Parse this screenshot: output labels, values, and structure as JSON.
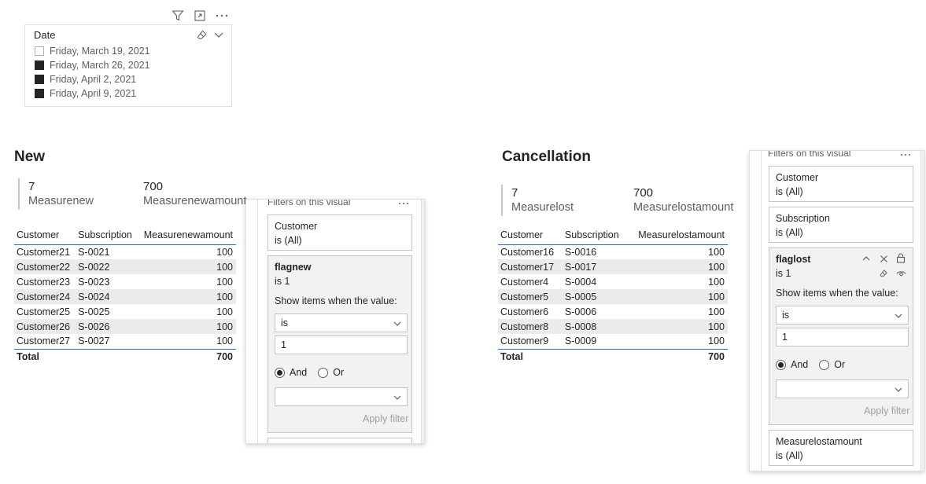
{
  "slicer": {
    "title": "Date",
    "items": [
      {
        "label": "Friday, March 19, 2021",
        "checked": false
      },
      {
        "label": "Friday, March 26, 2021",
        "checked": true
      },
      {
        "label": "Friday, April 2, 2021",
        "checked": true
      },
      {
        "label": "Friday, April 9, 2021",
        "checked": true
      }
    ]
  },
  "new": {
    "title": "New",
    "card1": {
      "value": "7",
      "label": "Measurenew"
    },
    "card2": {
      "value": "700",
      "label": "Measurenewamount"
    },
    "table": {
      "headers": [
        "Customer",
        "Subscription",
        "Measurenewamount"
      ],
      "rows": [
        [
          "Customer21",
          "S-0021",
          "100"
        ],
        [
          "Customer22",
          "S-0022",
          "100"
        ],
        [
          "Customer23",
          "S-0023",
          "100"
        ],
        [
          "Customer24",
          "S-0024",
          "100"
        ],
        [
          "Customer25",
          "S-0025",
          "100"
        ],
        [
          "Customer26",
          "S-0026",
          "100"
        ],
        [
          "Customer27",
          "S-0027",
          "100"
        ]
      ],
      "total_label": "Total",
      "total_value": "700"
    }
  },
  "cancel": {
    "title": "Cancellation",
    "card1": {
      "value": "7",
      "label": "Measurelost"
    },
    "card2": {
      "value": "700",
      "label": "Measurelostamount"
    },
    "table": {
      "headers": [
        "Customer",
        "Subscription",
        "Measurelostamount"
      ],
      "rows": [
        [
          "Customer16",
          "S-0016",
          "100"
        ],
        [
          "Customer17",
          "S-0017",
          "100"
        ],
        [
          "Customer4",
          "S-0004",
          "100"
        ],
        [
          "Customer5",
          "S-0005",
          "100"
        ],
        [
          "Customer6",
          "S-0006",
          "100"
        ],
        [
          "Customer8",
          "S-0008",
          "100"
        ],
        [
          "Customer9",
          "S-0009",
          "100"
        ]
      ],
      "total_label": "Total",
      "total_value": "700"
    }
  },
  "pane_left": {
    "header": "Filters on this visual",
    "customer": {
      "name": "Customer",
      "state": "is (All)"
    },
    "flag": {
      "name": "flagnew",
      "state": "is 1",
      "show_label": "Show items when the value:",
      "operator": "is",
      "value": "1",
      "and_label": "And",
      "or_label": "Or",
      "apply_label": "Apply filter"
    }
  },
  "pane_right": {
    "header": "Filters on this visual",
    "customer": {
      "name": "Customer",
      "state": "is (All)"
    },
    "subscription": {
      "name": "Subscription",
      "state": "is (All)"
    },
    "flag": {
      "name": "flaglost",
      "state": "is 1",
      "show_label": "Show items when the value:",
      "operator": "is",
      "value": "1",
      "and_label": "And",
      "or_label": "Or",
      "apply_label": "Apply filter"
    },
    "measure": {
      "name": "Measurelostamount",
      "state": "is (All)"
    }
  },
  "colors": {
    "accent": "#1e6fc8",
    "alt_row": "#ebebeb",
    "card_active": "#f3f2f1"
  }
}
